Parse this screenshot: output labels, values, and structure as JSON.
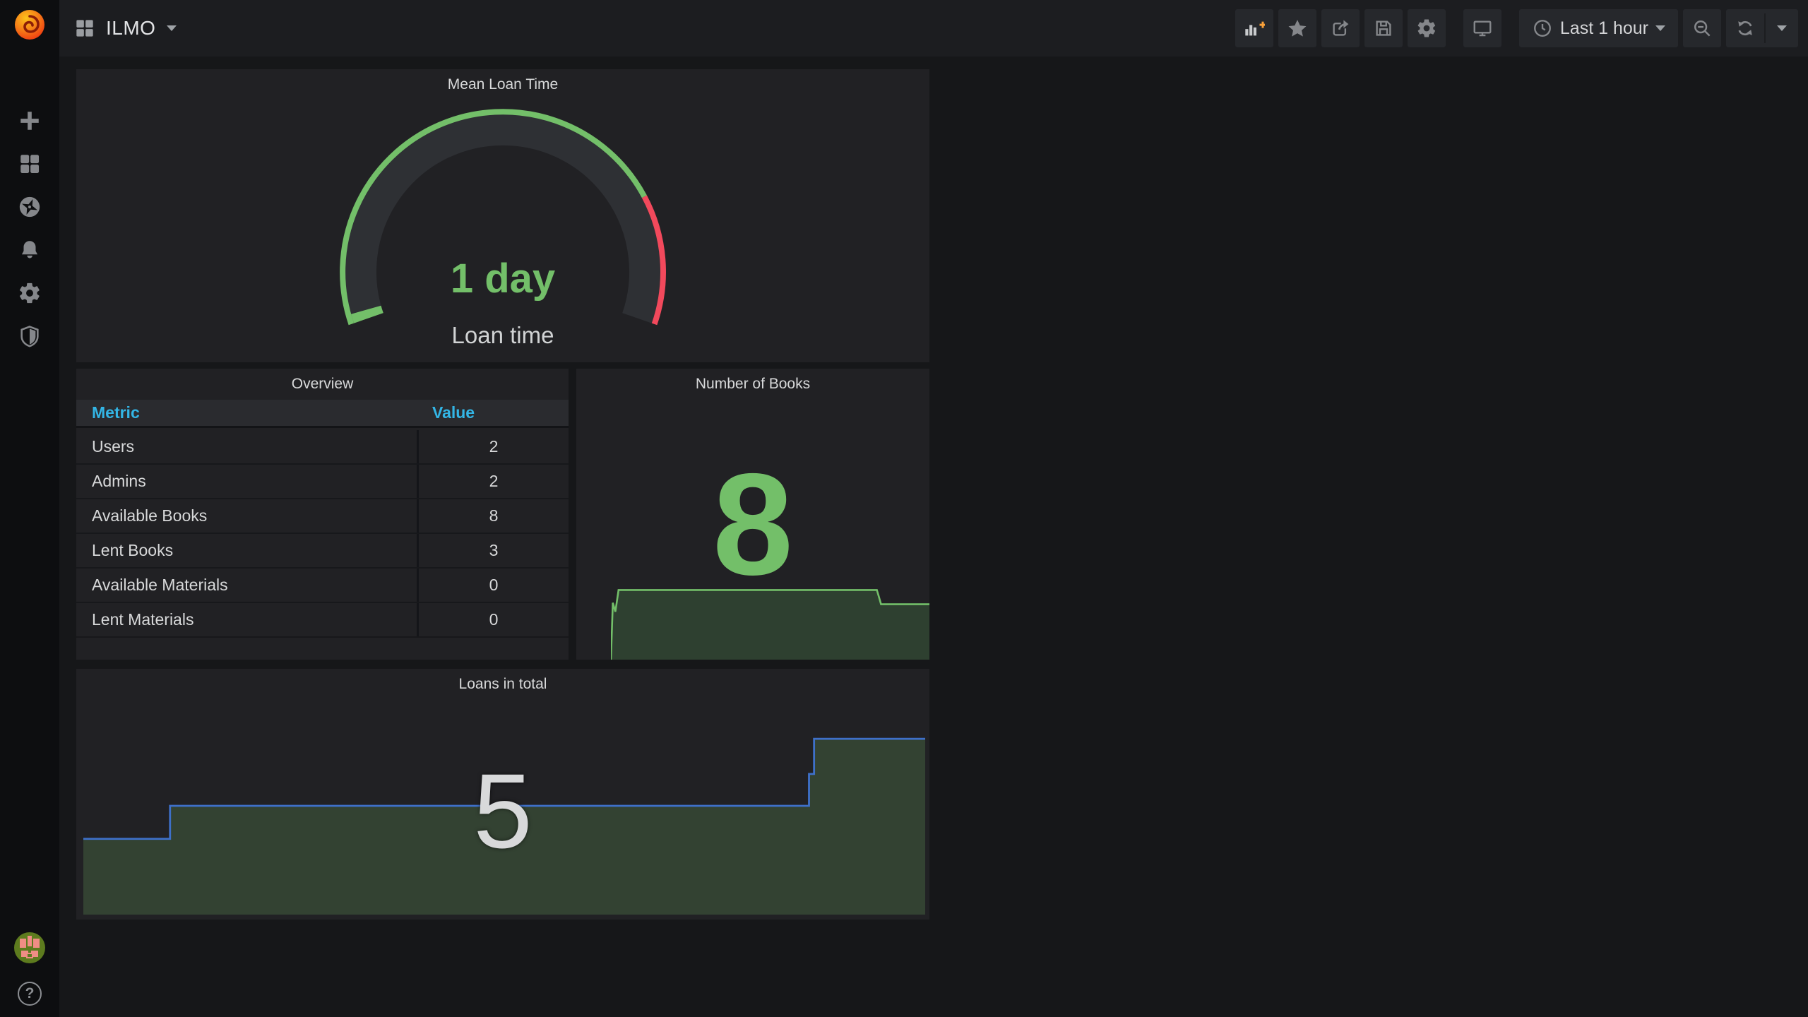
{
  "app": {
    "product": "Grafana",
    "page": "dashboard"
  },
  "theme": {
    "page_bg": "#161719",
    "panel_bg": "#212124",
    "sidebar_bg": "#0d0e10",
    "navbar_bg": "#1c1d20",
    "green": "#73BF69",
    "red": "#F2495C",
    "link_blue": "#33b5e5",
    "series_blue": "#3E70C9",
    "area_fill_green": "#334232",
    "text": "#d8d9da",
    "orange_accent": "#f9a13a"
  },
  "sidebar": {
    "logo": "grafana-logo",
    "menu": [
      {
        "id": "create",
        "icon": "plus-icon"
      },
      {
        "id": "dashboards",
        "icon": "dashboards-grid-icon"
      },
      {
        "id": "explore",
        "icon": "compass-icon"
      },
      {
        "id": "alerting",
        "icon": "bell-icon"
      },
      {
        "id": "configuration",
        "icon": "gear-icon"
      },
      {
        "id": "server-admin",
        "icon": "shield-icon"
      }
    ],
    "bottom": {
      "profile_icon": "avatar",
      "help_icon": "question-mark-icon",
      "help_label": "?"
    }
  },
  "navbar": {
    "title": "ILMO",
    "title_icon": "dashboard-grid-icon",
    "actions": [
      {
        "id": "add-panel",
        "icon": "bar-chart-plus-icon"
      },
      {
        "id": "mark-favorite",
        "icon": "star-icon"
      },
      {
        "id": "share-dashboard",
        "icon": "share-icon"
      },
      {
        "id": "save-dashboard",
        "icon": "save-icon"
      },
      {
        "id": "dashboard-settings",
        "icon": "gear-icon"
      },
      {
        "id": "cycle-view-mode",
        "icon": "monitor-icon"
      }
    ],
    "time_picker": {
      "icon": "clock-icon",
      "label": "Last 1 hour"
    },
    "zoom_out_icon": "magnifier-minus-icon",
    "refresh_icon": "refresh-icon"
  },
  "panels": {
    "gauge": {
      "title": "Mean Loan Time",
      "value": "1 day",
      "label": "Loan time"
    },
    "overview": {
      "title": "Overview",
      "columns": [
        "Metric",
        "Value"
      ],
      "rows": [
        {
          "metric": "Users",
          "value": "2"
        },
        {
          "metric": "Admins",
          "value": "2"
        },
        {
          "metric": "Available Books",
          "value": "8"
        },
        {
          "metric": "Lent Books",
          "value": "3"
        },
        {
          "metric": "Available Materials",
          "value": "0"
        },
        {
          "metric": "Lent Materials",
          "value": "0"
        }
      ]
    },
    "books": {
      "title": "Number of Books",
      "value": "8"
    },
    "loans": {
      "title": "Loans in total",
      "value": "5"
    }
  },
  "chart_data": [
    {
      "id": "mean-loan-time-gauge",
      "type": "gauge",
      "title": "Mean Loan Time",
      "value_text": "1 day",
      "value_days": 1,
      "label": "Loan time",
      "arc": {
        "start_angle": -109,
        "end_angle": 109,
        "threshold_split_angle": 62
      },
      "colors": {
        "track": "#2e3034",
        "green": "#73BF69",
        "red": "#F2495C"
      }
    },
    {
      "id": "number-of-books-sparkline",
      "type": "area",
      "title": "Number of Books",
      "current_value": 8,
      "estimated_series": [
        0,
        7,
        6.5,
        8,
        8,
        8,
        8,
        8,
        8,
        8,
        7.5,
        7.5
      ],
      "points_norm": [
        [
          0,
          100
        ],
        [
          0.6,
          24
        ],
        [
          1.4,
          36
        ],
        [
          2.4,
          7
        ],
        [
          83.5,
          7
        ],
        [
          84.2,
          17
        ],
        [
          84.8,
          26
        ],
        [
          100,
          26
        ]
      ],
      "line_color": "#73BF69",
      "fill_color": "#2e4030"
    },
    {
      "id": "loans-in-total-area",
      "type": "area",
      "title": "Loans in total",
      "current_value": 5,
      "estimated_series": [
        3,
        3,
        4,
        4,
        4,
        4,
        4,
        4,
        4,
        4.5,
        5,
        5
      ],
      "points_norm": [
        [
          0,
          61
        ],
        [
          10.3,
          61
        ],
        [
          10.3,
          44
        ],
        [
          86.2,
          44
        ],
        [
          86.2,
          27.6
        ],
        [
          86.8,
          27.6
        ],
        [
          86.8,
          9.5
        ],
        [
          100,
          9.5
        ]
      ],
      "line_color": "#3E70C9",
      "fill_color": "#334232"
    }
  ]
}
